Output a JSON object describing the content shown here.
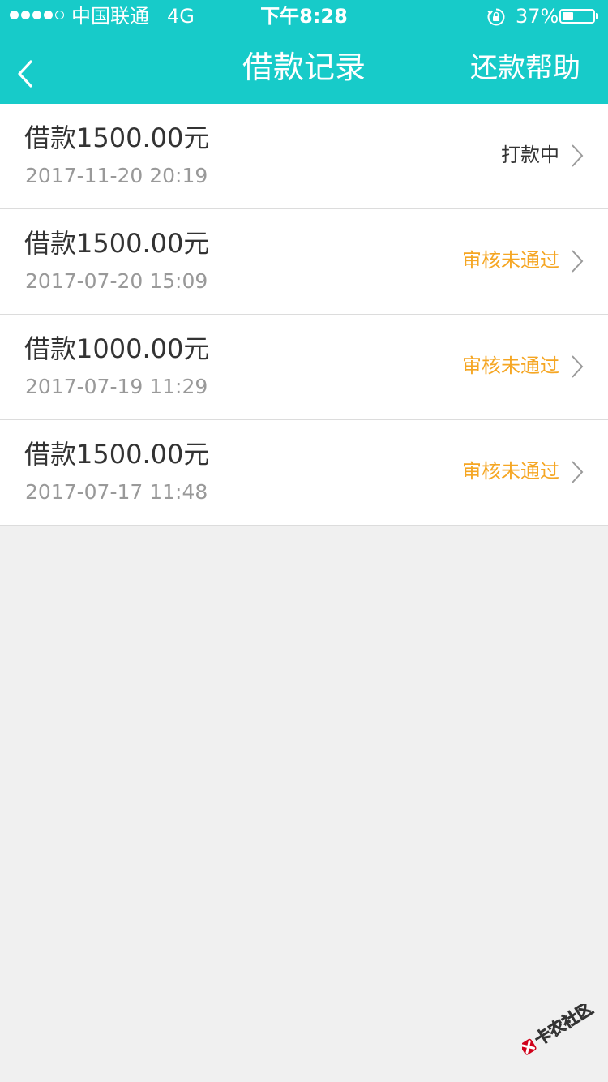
{
  "status_bar": {
    "carrier": "中国联通",
    "network": "4G",
    "time": "下午8:28",
    "battery_percent": "37%",
    "battery_level": 0.37,
    "signal_bars": 4,
    "signal_total": 5
  },
  "nav": {
    "title": "借款记录",
    "right_label": "还款帮助",
    "back_icon": "chevron-left-icon"
  },
  "colors": {
    "header_bg": "#17cbc9",
    "status_normal": "#333333",
    "status_rejected": "#f5a623",
    "page_bg": "#f0f0f0"
  },
  "records": [
    {
      "amount": "借款1500.00元",
      "date": "2017-11-20 20:19",
      "status": "打款中",
      "status_color": "#333333"
    },
    {
      "amount": "借款1500.00元",
      "date": "2017-07-20 15:09",
      "status": "审核未通过",
      "status_color": "#f5a623"
    },
    {
      "amount": "借款1000.00元",
      "date": "2017-07-19 11:29",
      "status": "审核未通过",
      "status_color": "#f5a623"
    },
    {
      "amount": "借款1500.00元",
      "date": "2017-07-17 11:48",
      "status": "审核未通过",
      "status_color": "#f5a623"
    }
  ],
  "watermark": {
    "text": "卡农社区"
  }
}
